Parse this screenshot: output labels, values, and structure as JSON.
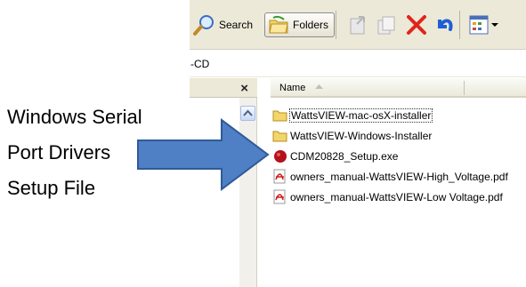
{
  "toolbar": {
    "search_label": "Search",
    "folders_label": "Folders"
  },
  "address": {
    "value": "-CD"
  },
  "left_pane": {
    "close_label": "×"
  },
  "file_list": {
    "column_header": "Name",
    "items": [
      {
        "name": "WattsVIEW-mac-osX-installer",
        "icon": "folder-icon"
      },
      {
        "name": "WattsVIEW-Windows-Installer",
        "icon": "folder-icon"
      },
      {
        "name": "CDM20828_Setup.exe",
        "icon": "setup-exe-icon"
      },
      {
        "name": "owners_manual-WattsVIEW-High_Voltage.pdf",
        "icon": "pdf-icon"
      },
      {
        "name": "owners_manual-WattsVIEW-Low Voltage.pdf",
        "icon": "pdf-icon"
      }
    ]
  },
  "annotation": {
    "line1": "Windows Serial",
    "line2": "Port Drivers",
    "line3": "Setup File",
    "arrow_color": "#4f7fc4"
  },
  "colors": {
    "toolbar_bg": "#ece9d8",
    "delete_red": "#e0251b",
    "undo_blue": "#1f5fd6",
    "folder_yellow": "#f3d56a"
  }
}
